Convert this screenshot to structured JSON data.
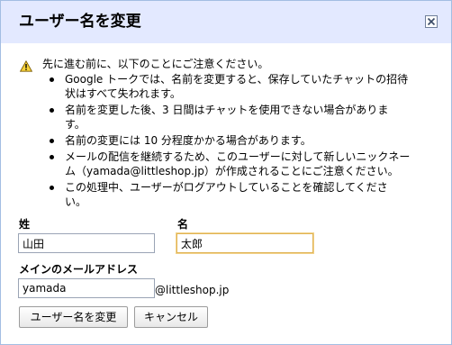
{
  "dialog": {
    "title": "ユーザー名を変更",
    "close_icon": "close-icon"
  },
  "warning": {
    "icon": "warning-icon",
    "intro": "先に進む前に、以下のことにご注意ください。",
    "items": [
      "Google トークでは、名前を変更すると、保存していたチャットの招待\n状はすべて失われます。",
      "名前を変更した後、3 日間はチャットを使用できない場合がありま\nす。",
      "名前の変更には 10 分程度かかる場合があります。",
      "メールの配信を継続するため、このユーザーに対して新しいニックネー\nム（yamada@littleshop.jp）が作成されることにご注意ください。",
      "この処理中、ユーザーがログアウトしていることを確認してくださ\nい。"
    ]
  },
  "form": {
    "last_name_label": "姓",
    "last_name_value": "山田",
    "first_name_label": "名",
    "first_name_value": "太郎",
    "email_label": "メインのメールアドレス",
    "email_value": "yamada",
    "email_domain": "@littleshop.jp"
  },
  "buttons": {
    "rename": "ユーザー名を変更",
    "cancel": "キャンセル"
  }
}
